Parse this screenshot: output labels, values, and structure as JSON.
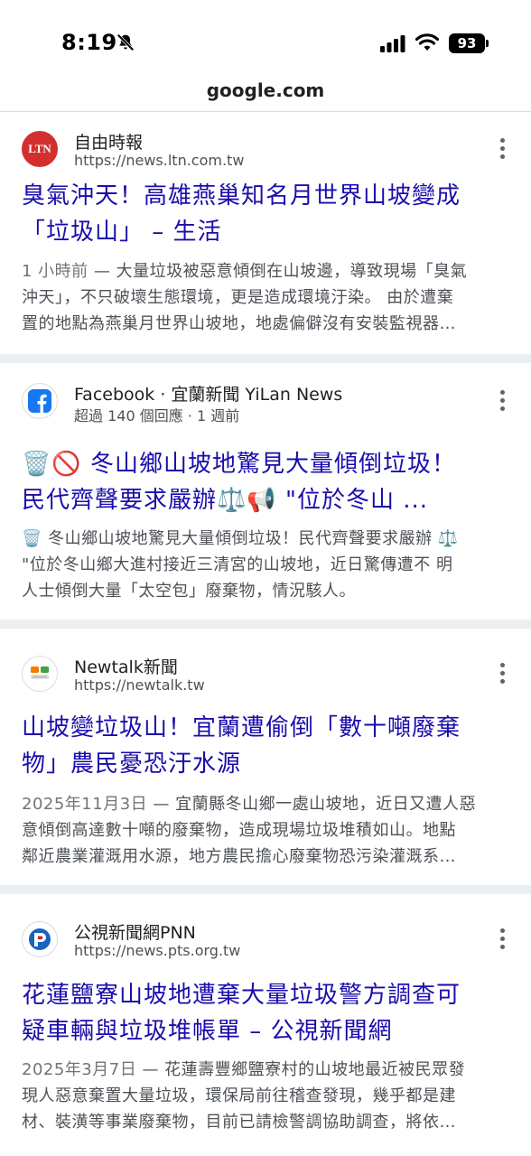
{
  "status_bar": {
    "time": "8:19",
    "battery": "93"
  },
  "browser": {
    "url": "google.com"
  },
  "results": [
    {
      "favicon_text": "LTN",
      "favicon_color": "#d32f2f",
      "source": "自由時報",
      "url": "https://news.ltn.com.tw",
      "title_lines": [
        "臭氣沖天！高雄燕巢知名月世界山坡變成",
        "「垃圾山」 – 生活"
      ],
      "date": "1 小時前",
      "snippet_lines": [
        " — 大量垃圾被惡意傾倒在山坡邊，導致現場「臭氣",
        "沖天」，不只破壞生態環境，更是造成環境汙染。 由於遭棄",
        "置的地點為燕巢月世界山坡地，地處偏僻沒有安裝監視器…"
      ]
    },
    {
      "favicon_text": "f",
      "favicon_color": "#1877f2",
      "source": "Facebook · 宜蘭新聞 YiLan News",
      "meta": "超過 140 個回應 · 1 週前",
      "title_lines": [
        "🗑️🚫 冬山鄉山坡地驚見大量傾倒垃圾！",
        "民代齊聲要求嚴辦⚖️📢 \"位於冬山 ..."
      ],
      "snippet_lines": [
        "🗑️ 冬山鄉山坡地驚見大量傾倒垃圾！民代齊聲要求嚴辦 ⚖️",
        "\"位於冬山鄉大進村接近三清宮的山坡地，近日驚傳遭不 明",
        "人士傾倒大量「太空包」廢棄物，情況駭人。"
      ]
    },
    {
      "favicon_text": "Newtalk",
      "favicon_color": "#e65100",
      "source": "Newtalk新聞",
      "url": "https://newtalk.tw",
      "title_lines": [
        "山坡變垃圾山！宜蘭遭偷倒「數十噸廢棄",
        "物」農民憂恐汙水源"
      ],
      "date": "2025年11月3日",
      "snippet_lines": [
        " — 宜蘭縣冬山鄉一處山坡地，近日又遭人惡",
        "意傾倒高達數十噸的廢棄物，造成現場垃圾堆積如山。地點",
        "鄰近農業灌溉用水源，地方農民擔心廢棄物恐污染灌溉系…"
      ]
    },
    {
      "favicon_text": "P",
      "favicon_color": "#c62828",
      "source": "公視新聞網PNN",
      "url": "https://news.pts.org.tw",
      "title_lines": [
        "花蓮鹽寮山坡地遭棄大量垃圾警方調查可",
        "疑車輛與垃圾堆帳單 – 公視新聞網"
      ],
      "date": "2025年3月7日",
      "snippet_lines": [
        " — 花蓮壽豐鄉鹽寮村的山坡地最近被民眾發",
        "現人惡意棄置大量垃圾，環保局前往稽查發現，幾乎都是建",
        "材、裝潢等事業廢棄物，目前已請檢警調協助調查，將依…"
      ]
    }
  ]
}
